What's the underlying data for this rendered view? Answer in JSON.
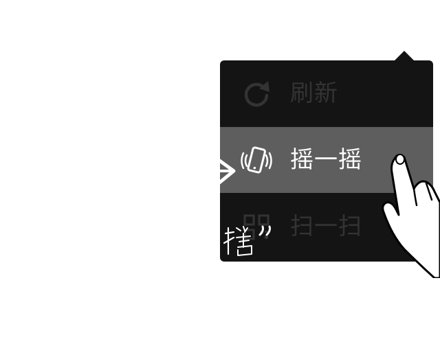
{
  "menu": {
    "items": [
      {
        "label": "刷新",
        "icon": "refresh-icon",
        "state": "disabled"
      },
      {
        "label": "摇一摇",
        "icon": "shake-phone-icon",
        "state": "highlighted"
      },
      {
        "label": "扫一扫",
        "icon": "qr-scan-icon",
        "state": "disabled"
      }
    ]
  },
  "colors": {
    "menu_background": "#141414",
    "highlight_background": "#5e5e5e",
    "active_text": "#ffffff",
    "disabled_text": "#333333"
  }
}
